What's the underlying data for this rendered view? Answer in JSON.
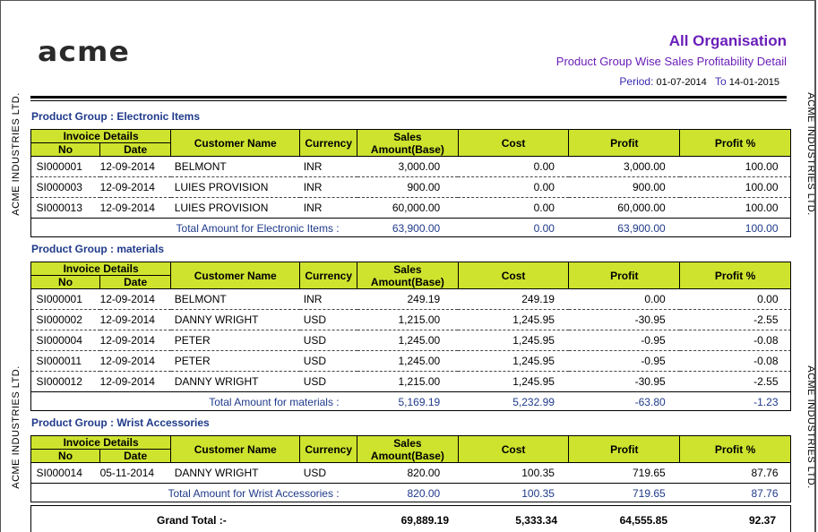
{
  "logo": "acme",
  "organisation": "All Organisation",
  "report_title": "Product Group Wise Sales Profitability Detail",
  "period": {
    "label_from": "Period:",
    "from": "01-07-2014",
    "label_to": "To",
    "to": "14-01-2015"
  },
  "side_text": "ACME INDUSTRIES LTD.",
  "headers": {
    "invoice_details": "Invoice Details",
    "no": "No",
    "date": "Date",
    "customer": "Customer Name",
    "currency": "Currency",
    "sales": "Sales Amount(Base)",
    "cost": "Cost",
    "profit": "Profit",
    "profit_pct": "Profit %"
  },
  "groups": [
    {
      "title": "Product Group : Electronic Items",
      "rows": [
        [
          "SI000001",
          "12-09-2014",
          "BELMONT",
          "INR",
          "3,000.00",
          "0.00",
          "3,000.00",
          "100.00"
        ],
        [
          "SI000003",
          "12-09-2014",
          "LUIES PROVISION",
          "INR",
          "900.00",
          "0.00",
          "900.00",
          "100.00"
        ],
        [
          "SI000013",
          "12-09-2014",
          "LUIES PROVISION",
          "INR",
          "60,000.00",
          "0.00",
          "60,000.00",
          "100.00"
        ]
      ],
      "total_label": "Total Amount for Electronic Items :",
      "total": [
        "63,900.00",
        "0.00",
        "63,900.00",
        "100.00"
      ]
    },
    {
      "title": "Product Group : materials",
      "rows": [
        [
          "SI000001",
          "12-09-2014",
          "BELMONT",
          "INR",
          "249.19",
          "249.19",
          "0.00",
          "0.00"
        ],
        [
          "SI000002",
          "12-09-2014",
          "DANNY WRIGHT",
          "USD",
          "1,215.00",
          "1,245.95",
          "-30.95",
          "-2.55"
        ],
        [
          "SI000004",
          "12-09-2014",
          "PETER",
          "USD",
          "1,245.00",
          "1,245.95",
          "-0.95",
          "-0.08"
        ],
        [
          "SI000011",
          "12-09-2014",
          "PETER",
          "USD",
          "1,245.00",
          "1,245.95",
          "-0.95",
          "-0.08"
        ],
        [
          "SI000012",
          "12-09-2014",
          "DANNY WRIGHT",
          "USD",
          "1,215.00",
          "1,245.95",
          "-30.95",
          "-2.55"
        ]
      ],
      "total_label": "Total Amount for materials :",
      "total": [
        "5,169.19",
        "5,232.99",
        "-63.80",
        "-1.23"
      ]
    },
    {
      "title": "Product Group : Wrist Accessories",
      "rows": [
        [
          "SI000014",
          "05-11-2014",
          "DANNY WRIGHT",
          "USD",
          "820.00",
          "100.35",
          "719.65",
          "87.76"
        ]
      ],
      "total_label": "Total Amount for Wrist Accessories :",
      "total": [
        "820.00",
        "100.35",
        "719.65",
        "87.76"
      ]
    }
  ],
  "grand_total": {
    "label": "Grand Total :-",
    "sales": "69,889.19",
    "cost": "5,333.34",
    "profit": "64,555.85",
    "profit_pct": "92.37"
  }
}
